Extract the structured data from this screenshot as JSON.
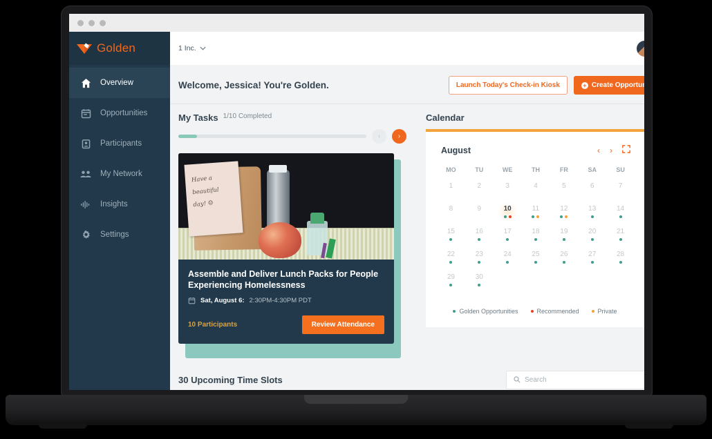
{
  "browser": {
    "dots": [
      "",
      "",
      ""
    ]
  },
  "sidebar": {
    "brand": "Golden",
    "items": [
      {
        "label": "Overview",
        "icon": "home-icon",
        "active": true
      },
      {
        "label": "Opportunities",
        "icon": "calendar-icon",
        "active": false
      },
      {
        "label": "Participants",
        "icon": "badge-icon",
        "active": false
      },
      {
        "label": "My Network",
        "icon": "people-icon",
        "active": false
      },
      {
        "label": "Insights",
        "icon": "waveform-icon",
        "active": false
      },
      {
        "label": "Settings",
        "icon": "gear-icon",
        "active": false
      }
    ]
  },
  "topbar": {
    "org": "1 Inc.",
    "chevron": "⌄"
  },
  "header": {
    "welcome": "Welcome, Jessica! You're Golden.",
    "kiosk_button": "Launch Today's Check-in Kiosk",
    "create_button": "Create Opportunity",
    "create_plus": "+"
  },
  "tasks": {
    "title": "My Tasks",
    "subtitle": "1/10 Completed",
    "progress_percent": 10,
    "prev_arrow": "‹",
    "next_arrow": "›",
    "card": {
      "title": "Assemble and Deliver Lunch Packs for People Experiencing Homelessness",
      "date": "Sat, August 6:",
      "time": "2:30PM-4:30PM PDT",
      "participants": "10 Participants",
      "review_button": "Review Attendance",
      "photo_note_lines": [
        "Have a",
        "beautiful",
        "day! ☺"
      ]
    }
  },
  "calendar": {
    "section_title": "Calendar",
    "month": "August",
    "prev": "‹",
    "next": "›",
    "expand_icon": "expand-icon",
    "dow": [
      "MO",
      "TU",
      "WE",
      "TH",
      "FR",
      "SA",
      "SU"
    ],
    "days": [
      {
        "n": "1",
        "dots": []
      },
      {
        "n": "2",
        "dots": []
      },
      {
        "n": "3",
        "dots": []
      },
      {
        "n": "4",
        "dots": []
      },
      {
        "n": "5",
        "dots": []
      },
      {
        "n": "6",
        "dots": []
      },
      {
        "n": "7",
        "dots": []
      },
      {
        "n": "8",
        "dots": []
      },
      {
        "n": "9",
        "dots": []
      },
      {
        "n": "10",
        "dots": [
          "golden",
          "recommended"
        ],
        "today": true
      },
      {
        "n": "11",
        "dots": [
          "golden",
          "private"
        ]
      },
      {
        "n": "12",
        "dots": [
          "golden",
          "private"
        ]
      },
      {
        "n": "13",
        "dots": [
          "golden"
        ]
      },
      {
        "n": "14",
        "dots": [
          "golden"
        ]
      },
      {
        "n": "15",
        "dots": [
          "golden"
        ]
      },
      {
        "n": "16",
        "dots": [
          "golden"
        ]
      },
      {
        "n": "17",
        "dots": [
          "golden"
        ]
      },
      {
        "n": "18",
        "dots": [
          "golden"
        ]
      },
      {
        "n": "19",
        "dots": [
          "golden"
        ]
      },
      {
        "n": "20",
        "dots": [
          "golden"
        ]
      },
      {
        "n": "21",
        "dots": [
          "golden"
        ]
      },
      {
        "n": "22",
        "dots": [
          "golden"
        ]
      },
      {
        "n": "23",
        "dots": [
          "golden"
        ]
      },
      {
        "n": "24",
        "dots": [
          "golden"
        ]
      },
      {
        "n": "25",
        "dots": [
          "golden"
        ]
      },
      {
        "n": "26",
        "dots": [
          "golden"
        ]
      },
      {
        "n": "27",
        "dots": [
          "golden"
        ]
      },
      {
        "n": "28",
        "dots": [
          "golden"
        ]
      },
      {
        "n": "29",
        "dots": [
          "golden"
        ]
      },
      {
        "n": "30",
        "dots": [
          "golden"
        ]
      }
    ],
    "legend": [
      {
        "label": "Golden Opportunities",
        "color": "#3f9e8c"
      },
      {
        "label": "Recommended",
        "color": "#e8431f"
      },
      {
        "label": "Private",
        "color": "#f2a33c"
      }
    ]
  },
  "bottom": {
    "title": "30 Upcoming Time Slots",
    "search_placeholder": "Search",
    "search_value": ""
  },
  "colors": {
    "brand_orange": "#f0671e",
    "sidebar_navy": "#21394a",
    "teal": "#3f9e8c",
    "amber": "#f2a33c"
  }
}
